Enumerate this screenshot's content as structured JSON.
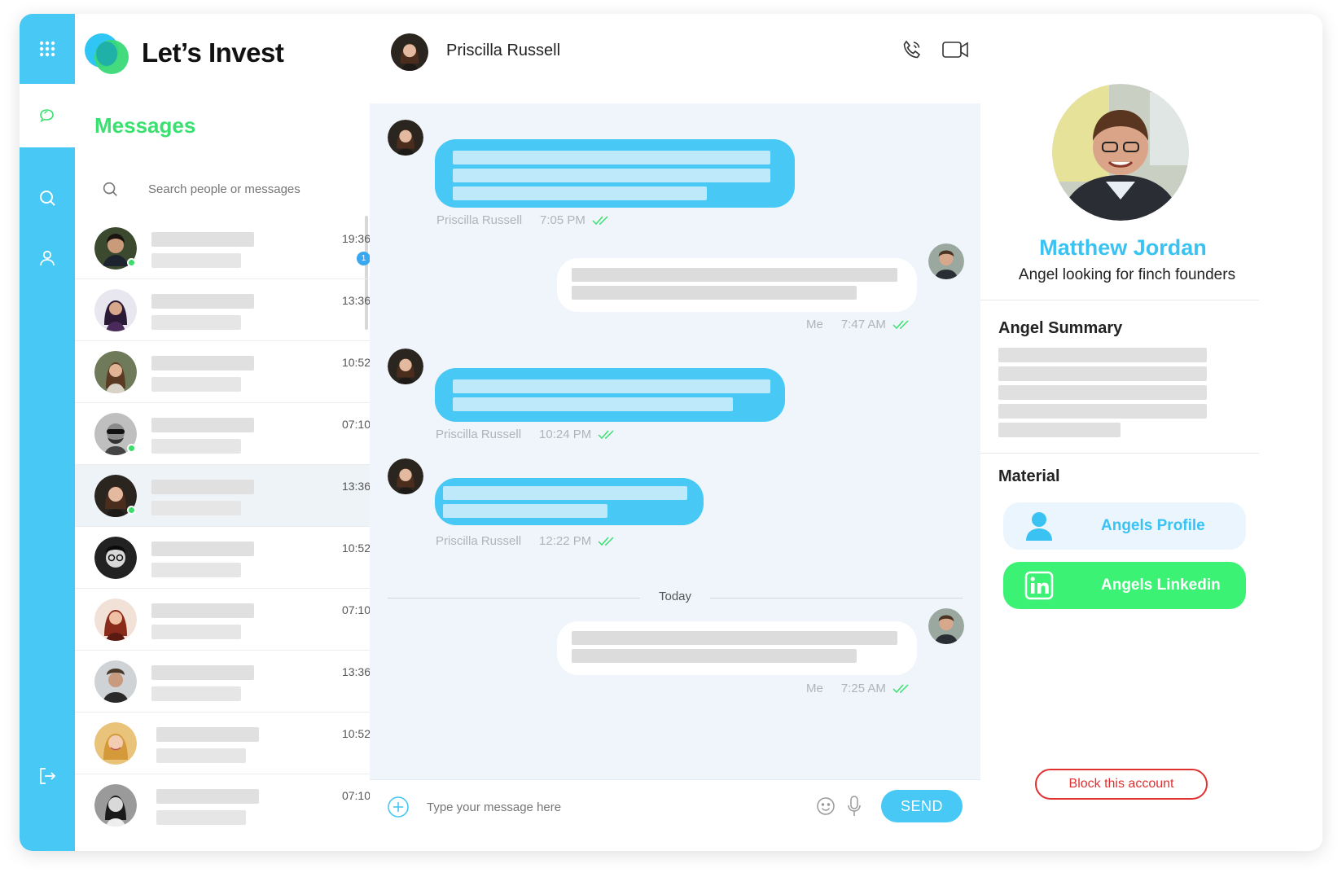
{
  "app": {
    "name": "Let’s Invest"
  },
  "nav": {
    "items": [
      {
        "name": "apps-grid-icon"
      },
      {
        "name": "chat-bubbles-icon"
      },
      {
        "name": "search-icon"
      },
      {
        "name": "user-icon"
      },
      {
        "name": "logout-icon"
      }
    ]
  },
  "messages": {
    "title": "Messages",
    "search_placeholder": "Search people or messages",
    "conversations": [
      {
        "time": "19:36",
        "unread": "1",
        "online": true
      },
      {
        "time": "13:36",
        "online": false
      },
      {
        "time": "10:52",
        "online": false
      },
      {
        "time": "07:10",
        "online": true
      },
      {
        "time": "13:36",
        "online": true,
        "selected": true
      },
      {
        "time": "10:52",
        "online": false
      },
      {
        "time": "07:10",
        "online": false
      },
      {
        "time": "13:36",
        "online": false
      },
      {
        "time": "10:52",
        "online": false
      },
      {
        "time": "07:10",
        "online": false
      }
    ]
  },
  "chat": {
    "contact_name": "Priscilla Russell",
    "messages": [
      {
        "sender": "Priscilla Russell",
        "time": "7:05 PM"
      },
      {
        "sender": "Me",
        "time": "7:47 AM"
      },
      {
        "sender": "Priscilla Russell",
        "time": "10:24 PM"
      },
      {
        "sender": "Priscilla Russell",
        "time": "12:22 PM"
      },
      {
        "sender": "Me",
        "time": "7:25 AM"
      }
    ],
    "divider_label": "Today",
    "composer_placeholder": "Type your message here",
    "send_label": "SEND"
  },
  "profile": {
    "name": "Matthew Jordan",
    "subtitle": "Angel looking for finch founders",
    "summary_heading": "Angel Summary",
    "material_heading": "Material",
    "material_profile_label": "Angels Profile",
    "material_linkedin_label": "Angels Linkedin",
    "block_label": "Block this account"
  },
  "colors": {
    "accent_blue": "#47c8f5",
    "accent_green": "#3ae070",
    "chat_bg": "#eff5fb",
    "danger": "#e03030"
  }
}
